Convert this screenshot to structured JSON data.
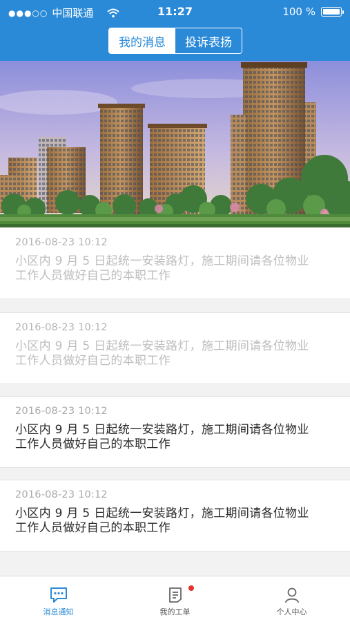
{
  "status_bar": {
    "signal_dots": "●●●○○",
    "carrier": "中国联通",
    "time": "11:27",
    "battery_text": "100 %",
    "icons": [
      "wifi-icon",
      "battery-icon"
    ]
  },
  "header": {
    "tabs": [
      {
        "label": "我的消息",
        "active": true
      },
      {
        "label": "投诉表扬",
        "active": false
      }
    ],
    "background_color": "#2b8ad8"
  },
  "banner": {
    "image_description_icon": "residential-buildings-banner"
  },
  "messages": [
    {
      "date": "2016-08-23 10:12",
      "text_line1": "小区内 9 月 5 日起统一安装路灯，施工期间请各位物业",
      "text_line2": "工作人员做好自己的本职工作",
      "read": true
    },
    {
      "date": "2016-08-23 10:12",
      "text_line1": "小区内 9 月 5 日起统一安装路灯，施工期间请各位物业",
      "text_line2": "工作人员做好自己的本职工作",
      "read": true
    },
    {
      "date": "2016-08-23 10:12",
      "text_line1": "小区内 9 月 5 日起统一安装路灯，施工期间请各位物业",
      "text_line2": "工作人员做好自己的本职工作",
      "read": false
    },
    {
      "date": "2016-08-23 10:12",
      "text_line1": "小区内 9 月 5 日起统一安装路灯，施工期间请各位物业",
      "text_line2": "工作人员做好自己的本职工作",
      "read": false
    }
  ],
  "tabbar": {
    "items": [
      {
        "label": "消息通知",
        "icon": "message-icon",
        "active": true
      },
      {
        "label": "我的工单",
        "icon": "work-order-icon",
        "active": false,
        "badge": true
      },
      {
        "label": "个人中心",
        "icon": "person-icon",
        "active": false
      }
    ]
  },
  "colors": {
    "accent": "#2b8ad8",
    "badge": "#e5322d"
  }
}
